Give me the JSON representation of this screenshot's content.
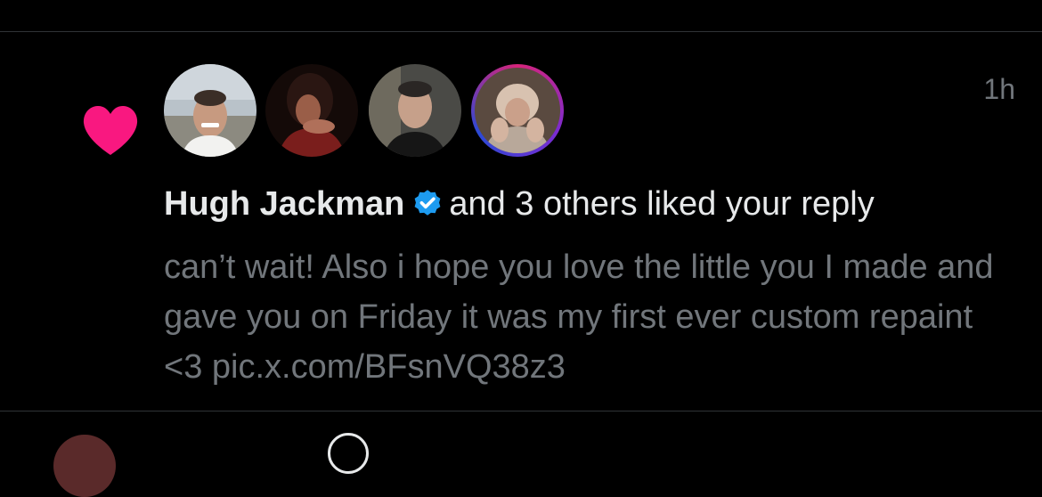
{
  "notification": {
    "type_icon": "heart-icon",
    "accent_color": "#f91880",
    "timestamp": "1h",
    "avatars": [
      {
        "name": "avatar-hugh-jackman"
      },
      {
        "name": "avatar-user-2"
      },
      {
        "name": "avatar-user-3"
      },
      {
        "name": "avatar-user-4"
      }
    ],
    "actor_name": "Hugh Jackman",
    "verified_icon": "verified-badge-icon",
    "verified_color": "#1d9bf0",
    "action_text": "and 3 others liked your reply",
    "reply_text": "can’t wait! Also i hope you love the little you I made and gave you on Friday it was my first ever custom repaint <3 pic.x.com/BFsnVQ38z3"
  }
}
